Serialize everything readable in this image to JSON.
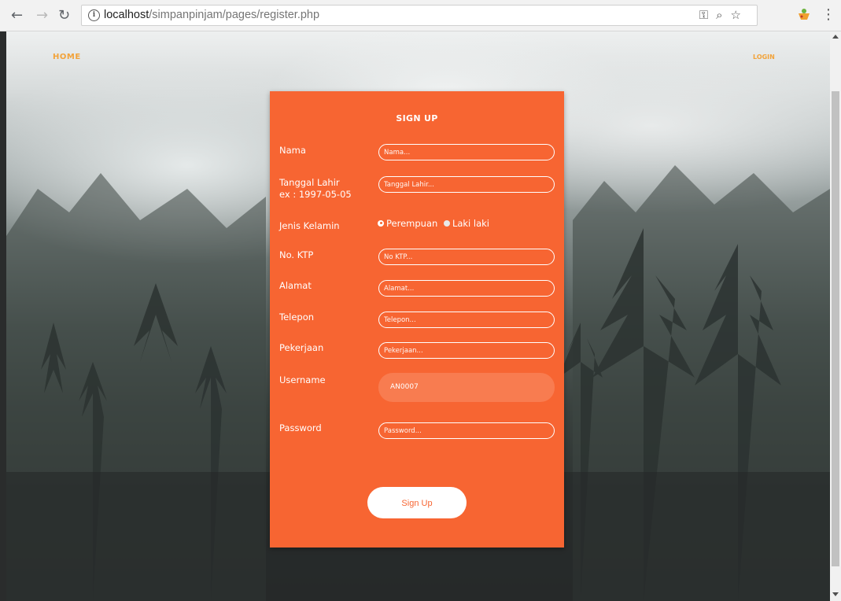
{
  "browser": {
    "url_host": "localhost",
    "url_path": "/simpanpinjam/pages/register.php"
  },
  "nav": {
    "home": "HOME",
    "login": "LOGIN"
  },
  "form": {
    "title": "SIGN UP",
    "nama_label": "Nama",
    "nama_placeholder": "Nama...",
    "tgl_label": "Tanggal Lahir",
    "tgl_hint": "ex : 1997-05-05",
    "tgl_placeholder": "Tanggal Lahir...",
    "jk_label": "Jenis Kelamin",
    "jk_option1": "Perempuan",
    "jk_option2": "Laki laki",
    "jk_selected": "Perempuan",
    "ktp_label": "No. KTP",
    "ktp_placeholder": "No KTP...",
    "alamat_label": "Alamat",
    "alamat_placeholder": "Alamat...",
    "telepon_label": "Telepon",
    "telepon_placeholder": "Telepon...",
    "pekerjaan_label": "Pekerjaan",
    "pekerjaan_placeholder": "Pekerjaan...",
    "username_label": "Username",
    "username_value": "AN0007",
    "password_label": "Password",
    "password_placeholder": "Password...",
    "submit_label": "Sign Up"
  },
  "colors": {
    "card": "#f76532",
    "nav_link": "#f2a33a"
  }
}
